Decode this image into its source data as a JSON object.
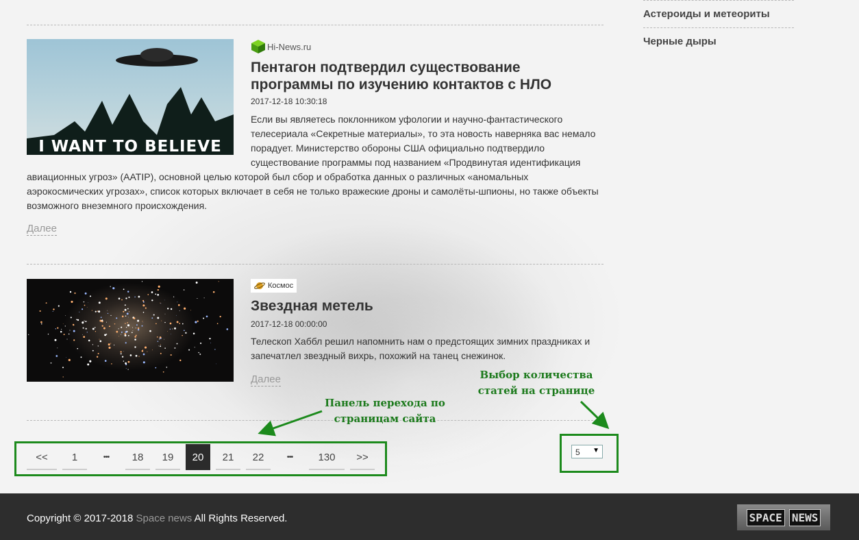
{
  "sidebar": {
    "items": [
      {
        "label": "Астероиды и метеориты"
      },
      {
        "label": "Черные дыры"
      }
    ]
  },
  "articles": [
    {
      "source": "Hi-News.ru",
      "source_icon": "green-cube-icon",
      "image_caption": "I WANT TO BELIEVE",
      "title": "Пентагон подтвердил существование программы по изучению контактов с НЛО",
      "date": "2017-12-18 10:30:18",
      "text": "Если вы являетесь поклонником уфологии и научно-фантастического телесериала «Секретные материалы», то эта новость наверняка вас немало порадует. Министерство обороны США официально подтвердило существование программы под названием «Продвинутая идентификация авиационных угроз» (AATIP), основной целью которой был сбор и обработка данных о различных «аномальных аэрокосмических угрозах», список которых включает в себя не только вражеские дроны и самолёты-шпионы, но также объекты возможного внеземного происхождения.",
      "more": "Далее"
    },
    {
      "source": "Космос",
      "source_icon": "planet-icon",
      "title": "Звездная метель",
      "date": "2017-12-18 00:00:00",
      "text": "Телескоп Хаббл решил напомнить нам о предстоящих зимних праздниках и запечатлел звездный вихрь, похожий на танец снежинок.",
      "more": "Далее"
    }
  ],
  "pagination": {
    "items": [
      "<<",
      "1",
      "•••",
      "18",
      "19",
      "20",
      "21",
      "22",
      "•••",
      "130",
      ">>"
    ],
    "active": "20"
  },
  "per_page": {
    "value": "5"
  },
  "annotations": {
    "pager_label": "Панель перехода по страницам сайта",
    "per_page_label": "Выбор количества статей на странице",
    "color": "#1c8a1c"
  },
  "footer": {
    "copyright_prefix": "Copyright © 2017-2018",
    "site_link": "Space news",
    "copyright_suffix": "All Rights Reserved.",
    "logo_word1": "SPACE",
    "logo_word2": "NEWS"
  }
}
